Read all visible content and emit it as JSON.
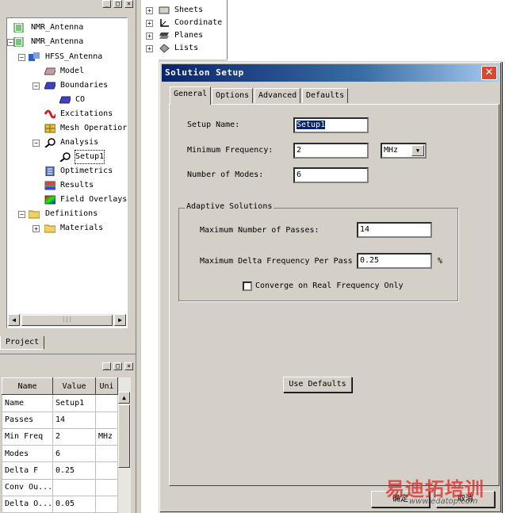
{
  "project_tree": {
    "items": [
      {
        "label": "NMR_Antenna"
      },
      {
        "label": "NMR_Antenna"
      },
      {
        "label": "HFSS_Antenna"
      },
      {
        "label": "Model"
      },
      {
        "label": "Boundaries"
      },
      {
        "label": "CO"
      },
      {
        "label": "Excitations"
      },
      {
        "label": "Mesh Operatior"
      },
      {
        "label": "Analysis"
      },
      {
        "label": "Setup1"
      },
      {
        "label": "Optimetrics"
      },
      {
        "label": "Results"
      },
      {
        "label": "Field Overlays"
      },
      {
        "label": "Definitions"
      },
      {
        "label": "Materials"
      }
    ],
    "tab_label": "Project"
  },
  "model_tree": {
    "items": [
      {
        "label": "Sheets"
      },
      {
        "label": "Coordinate"
      },
      {
        "label": "Planes"
      },
      {
        "label": "Lists"
      }
    ]
  },
  "properties": {
    "headers": [
      "Name",
      "Value",
      "Uni"
    ],
    "rows": [
      {
        "name": "Name",
        "value": "Setup1",
        "unit": ""
      },
      {
        "name": "Passes",
        "value": "14",
        "unit": ""
      },
      {
        "name": "Min Freq",
        "value": "2",
        "unit": "MHz"
      },
      {
        "name": "Modes",
        "value": "6",
        "unit": ""
      },
      {
        "name": "Delta F",
        "value": "0.25",
        "unit": ""
      },
      {
        "name": "Conv Ou...",
        "value": "",
        "unit": ""
      },
      {
        "name": "Delta O...",
        "value": "0.05",
        "unit": ""
      }
    ]
  },
  "dialog": {
    "title": "Solution Setup",
    "close_glyph": "✕",
    "tabs": [
      {
        "label": "General",
        "active": true
      },
      {
        "label": "Options",
        "active": false
      },
      {
        "label": "Advanced",
        "active": false
      },
      {
        "label": "Defaults",
        "active": false
      }
    ],
    "setup_name_label": "Setup Name:",
    "setup_name_value": "Setup1",
    "min_freq_label": "Minimum Frequency:",
    "min_freq_value": "2",
    "min_freq_unit": "MHz",
    "num_modes_label": "Number of Modes:",
    "num_modes_value": "6",
    "adaptive_group_label": "Adaptive Solutions",
    "max_passes_label": "Maximum Number of Passes:",
    "max_passes_value": "14",
    "max_delta_label": "Maximum Delta Frequency Per Pass",
    "max_delta_value": "0.25",
    "max_delta_unit": "%",
    "converge_label": "Converge on Real Frequency Only",
    "converge_checked": false,
    "use_defaults_label": "Use Defaults",
    "ok_label": "确定",
    "cancel_label": "取消"
  },
  "watermark": {
    "text": "易迪拓培训",
    "url": "www.edatop.com"
  },
  "colors": {
    "title_bar_start": "#0a246a",
    "title_bar_end": "#a6caf0",
    "close_button": "#d6492e",
    "watermark_red": "#dc2828"
  }
}
